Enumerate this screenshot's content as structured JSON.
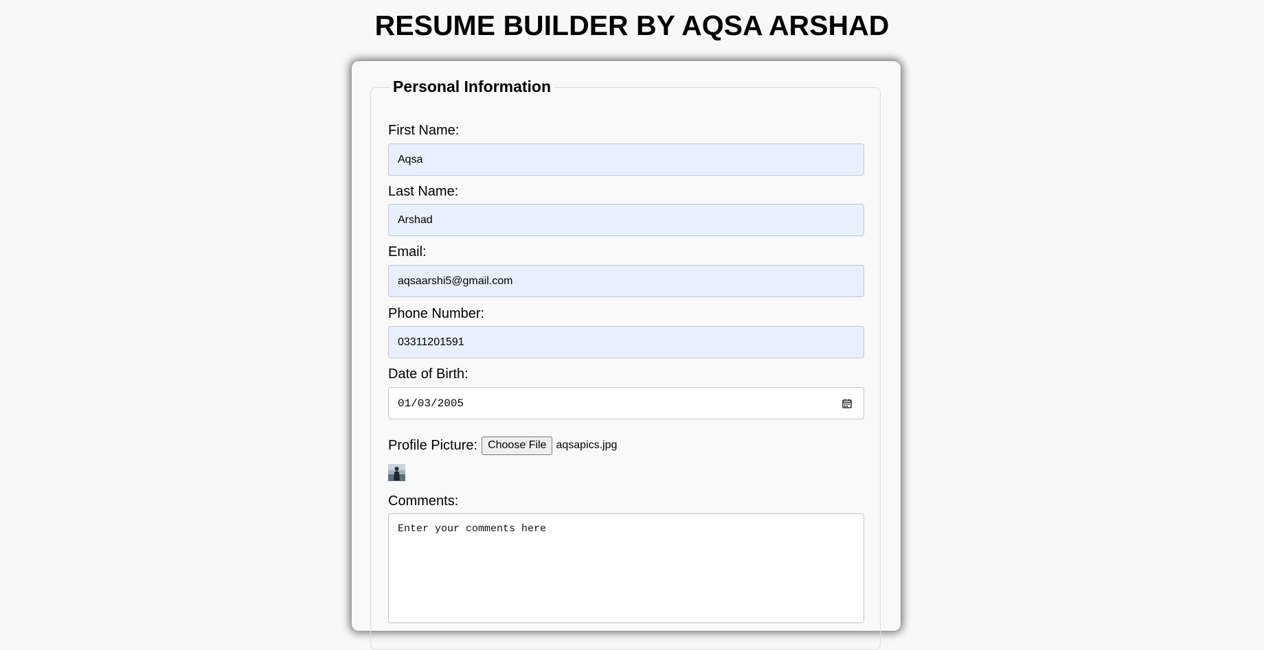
{
  "page": {
    "title": "RESUME BUILDER BY AQSA ARSHAD"
  },
  "form": {
    "legend": "Personal Information",
    "first_name": {
      "label": "First Name:",
      "value": "Aqsa"
    },
    "last_name": {
      "label": "Last Name:",
      "value": "Arshad"
    },
    "email": {
      "label": "Email:",
      "value": "aqsaarshi5@gmail.com"
    },
    "phone": {
      "label": "Phone Number:",
      "value": "03311201591"
    },
    "dob": {
      "label": "Date of Birth:",
      "value": "01/03/2005",
      "icon": "calendar-icon"
    },
    "profile_picture": {
      "label": "Profile Picture:",
      "button_label": "Choose File",
      "file_name": "aqsapics.jpg"
    },
    "comments": {
      "label": "Comments:",
      "placeholder": "Enter your comments here"
    }
  },
  "colors": {
    "background": "#f9f8f9",
    "autofill_bg": "#e8f0fd",
    "card_bg": "#faf9fa"
  }
}
